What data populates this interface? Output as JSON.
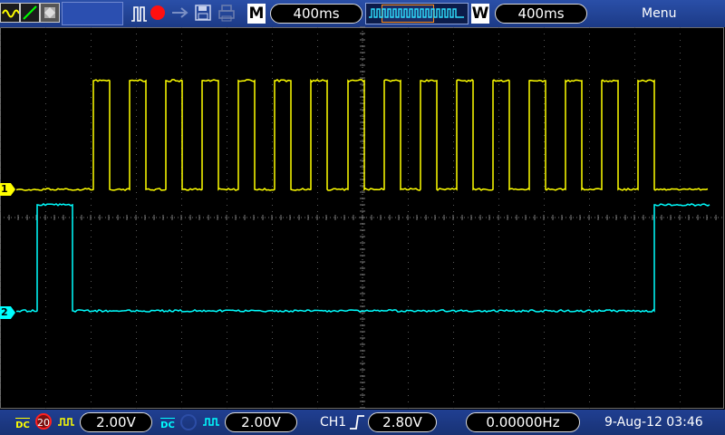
{
  "toolbar": {
    "math_icon": "math-wave-icon",
    "ramp_icon": "ramp-icon",
    "persist_icon": "persist-icon",
    "pulse_icon": "pulse-icon",
    "record_icon": "record-dot-icon",
    "usb_icon": "usb-icon",
    "save_icon": "floppy-save-icon",
    "print_icon": "printer-icon",
    "main_label": "M",
    "main_timebase": "400ms",
    "window_label": "W",
    "window_timebase": "400ms",
    "menu_label": "Menu"
  },
  "waveform": {
    "ch1_color": "#ffff00",
    "ch2_color": "#00ffff",
    "ch1_marker": "1",
    "ch2_marker": "2"
  },
  "status": {
    "ch1_coupling": "DC",
    "ch1_bw_limit": "20",
    "ch1_volts": "2.00V",
    "ch2_coupling": "DC",
    "ch2_volts": "2.00V",
    "trigger_source": "CH1",
    "trigger_level": "2.80V",
    "frequency": "0.00000Hz",
    "datetime": "9-Aug-12 03:46"
  }
}
